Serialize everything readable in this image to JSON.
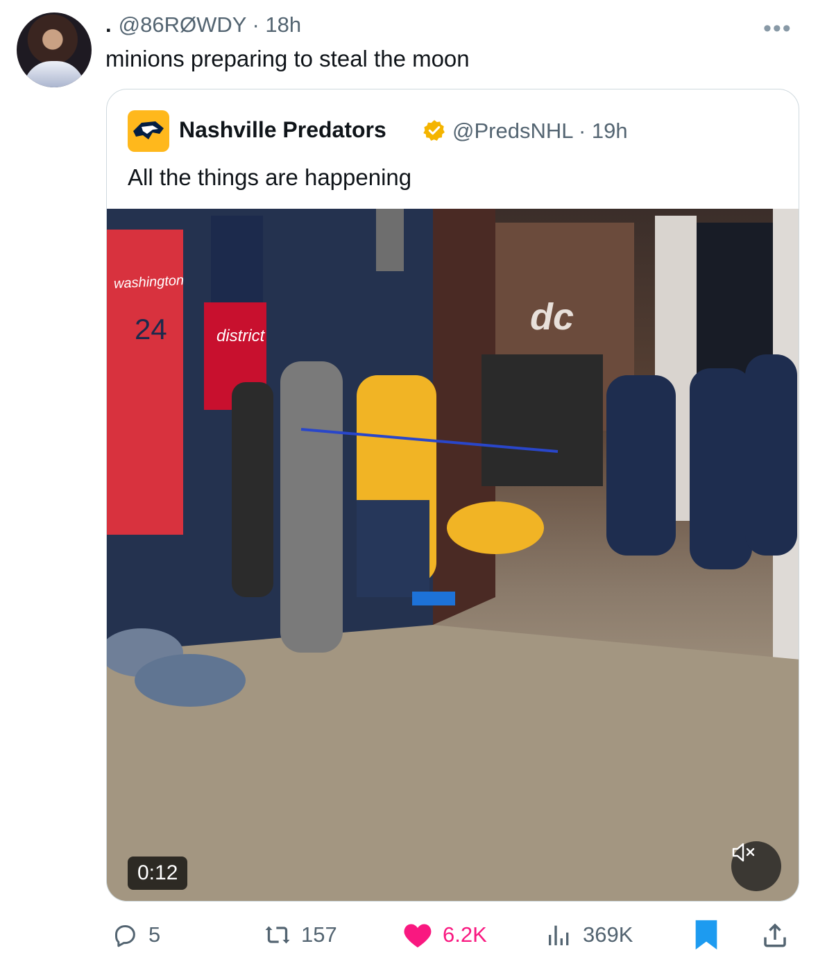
{
  "post": {
    "separator": ".",
    "handle": "@86RØWDY",
    "time": "· 18h",
    "text": "minions preparing to steal the moon"
  },
  "quoted": {
    "name": "Nashville Predators",
    "handle": "@PredsNHL",
    "time": "· 19h",
    "text": "All the things are happening",
    "video_time": "0:12",
    "jersey_text": "washington",
    "jersey_number": "24",
    "jersey2_text": "district",
    "wall_logo": "dc"
  },
  "actions": {
    "replies": "5",
    "reposts": "157",
    "likes": "6.2K",
    "views": "369K"
  },
  "colors": {
    "like": "#f91880",
    "bookmark": "#1d9bf0",
    "verified": "#f4b400",
    "preds_gold": "#ffb81c"
  },
  "icons": [
    "more-icon",
    "reply-icon",
    "repost-icon",
    "like-icon",
    "views-icon",
    "bookmark-icon",
    "share-icon",
    "mute-icon",
    "verified-icon"
  ]
}
